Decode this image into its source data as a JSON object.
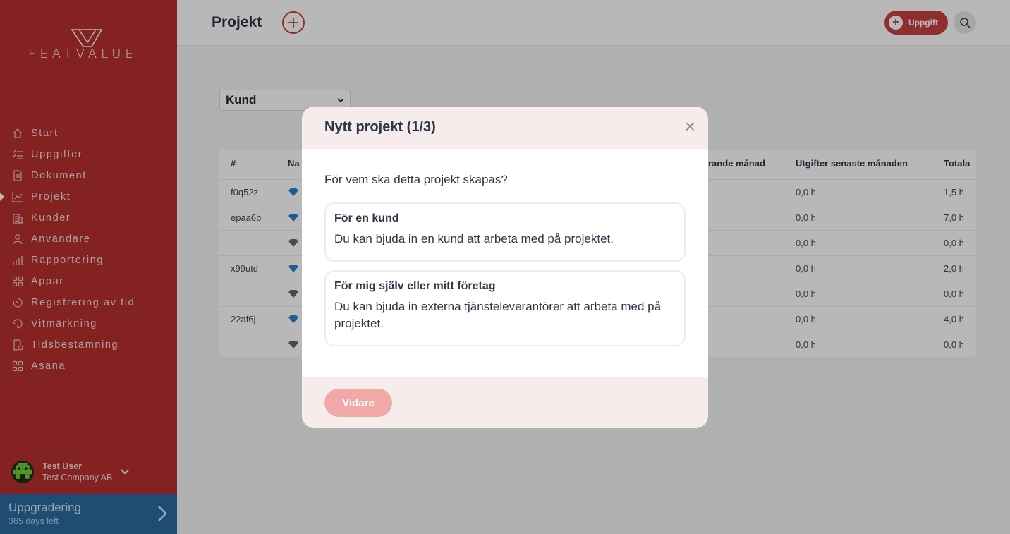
{
  "sidebar": {
    "brand": "FEATVALUE",
    "items": [
      {
        "label": "Start",
        "icon": "home-icon"
      },
      {
        "label": "Uppgifter",
        "icon": "tasks-icon"
      },
      {
        "label": "Dokument",
        "icon": "document-icon"
      },
      {
        "label": "Projekt",
        "icon": "chart-icon",
        "active": true
      },
      {
        "label": "Kunder",
        "icon": "building-icon"
      },
      {
        "label": "Användare",
        "icon": "user-icon"
      },
      {
        "label": "Rapportering",
        "icon": "bar-chart-icon"
      },
      {
        "label": "Appar",
        "icon": "apps-icon"
      },
      {
        "label": "Registrering av tid",
        "icon": "timer-icon"
      },
      {
        "label": "Vitmärkning",
        "icon": "tag-icon"
      },
      {
        "label": "Tidsbestämning",
        "icon": "calendar-clock-icon"
      },
      {
        "label": "Asana",
        "icon": "apps-icon"
      }
    ],
    "user": {
      "name": "Test User",
      "company": "Test Company AB"
    },
    "upgrade": {
      "title": "Uppgradering",
      "subtitle": "365 days left"
    }
  },
  "header": {
    "title": "Projekt",
    "task_button": "Uppgift"
  },
  "filter": {
    "selected": "Kund"
  },
  "table": {
    "headers": [
      "#",
      "Na",
      "rande månad",
      "Utgifter senaste månaden",
      "Totala"
    ],
    "rows": [
      {
        "id": "f0q52z",
        "gem": "blue",
        "expenses": "0,0 h",
        "total": "1,5 h"
      },
      {
        "id": "epaa6b",
        "gem": "blue",
        "expenses": "0,0 h",
        "total": "7,0 h"
      },
      {
        "id": "",
        "gem": "grey",
        "expenses": "0,0 h",
        "total": "0,0 h"
      },
      {
        "id": "x99utd",
        "gem": "blue",
        "expenses": "0,0 h",
        "total": "2,0 h"
      },
      {
        "id": "",
        "gem": "grey",
        "expenses": "0,0 h",
        "total": "0,0 h"
      },
      {
        "id": "22af6j",
        "gem": "blue",
        "expenses": "0,0 h",
        "total": "4,0 h"
      },
      {
        "id": "",
        "gem": "grey",
        "expenses": "0,0 h",
        "total": "0,0 h"
      }
    ]
  },
  "modal": {
    "title": "Nytt projekt (1/3)",
    "close": "×",
    "question": "För vem ska detta projekt skapas?",
    "options": [
      {
        "title": "För en kund",
        "description": "Du kan bjuda in en kund att arbeta med på projektet."
      },
      {
        "title": "För mig själv eller mitt företag",
        "description": "Du kan bjuda in externa tjänsteleverantörer att arbeta med på projektet."
      }
    ],
    "next_button": "Vidare"
  },
  "colors": {
    "sidebar": "#b8302f",
    "accent": "#c6403d",
    "upgrade": "#2c6a9e",
    "modal_band": "#f6ecec",
    "disabled_button": "#f0a9a6"
  }
}
